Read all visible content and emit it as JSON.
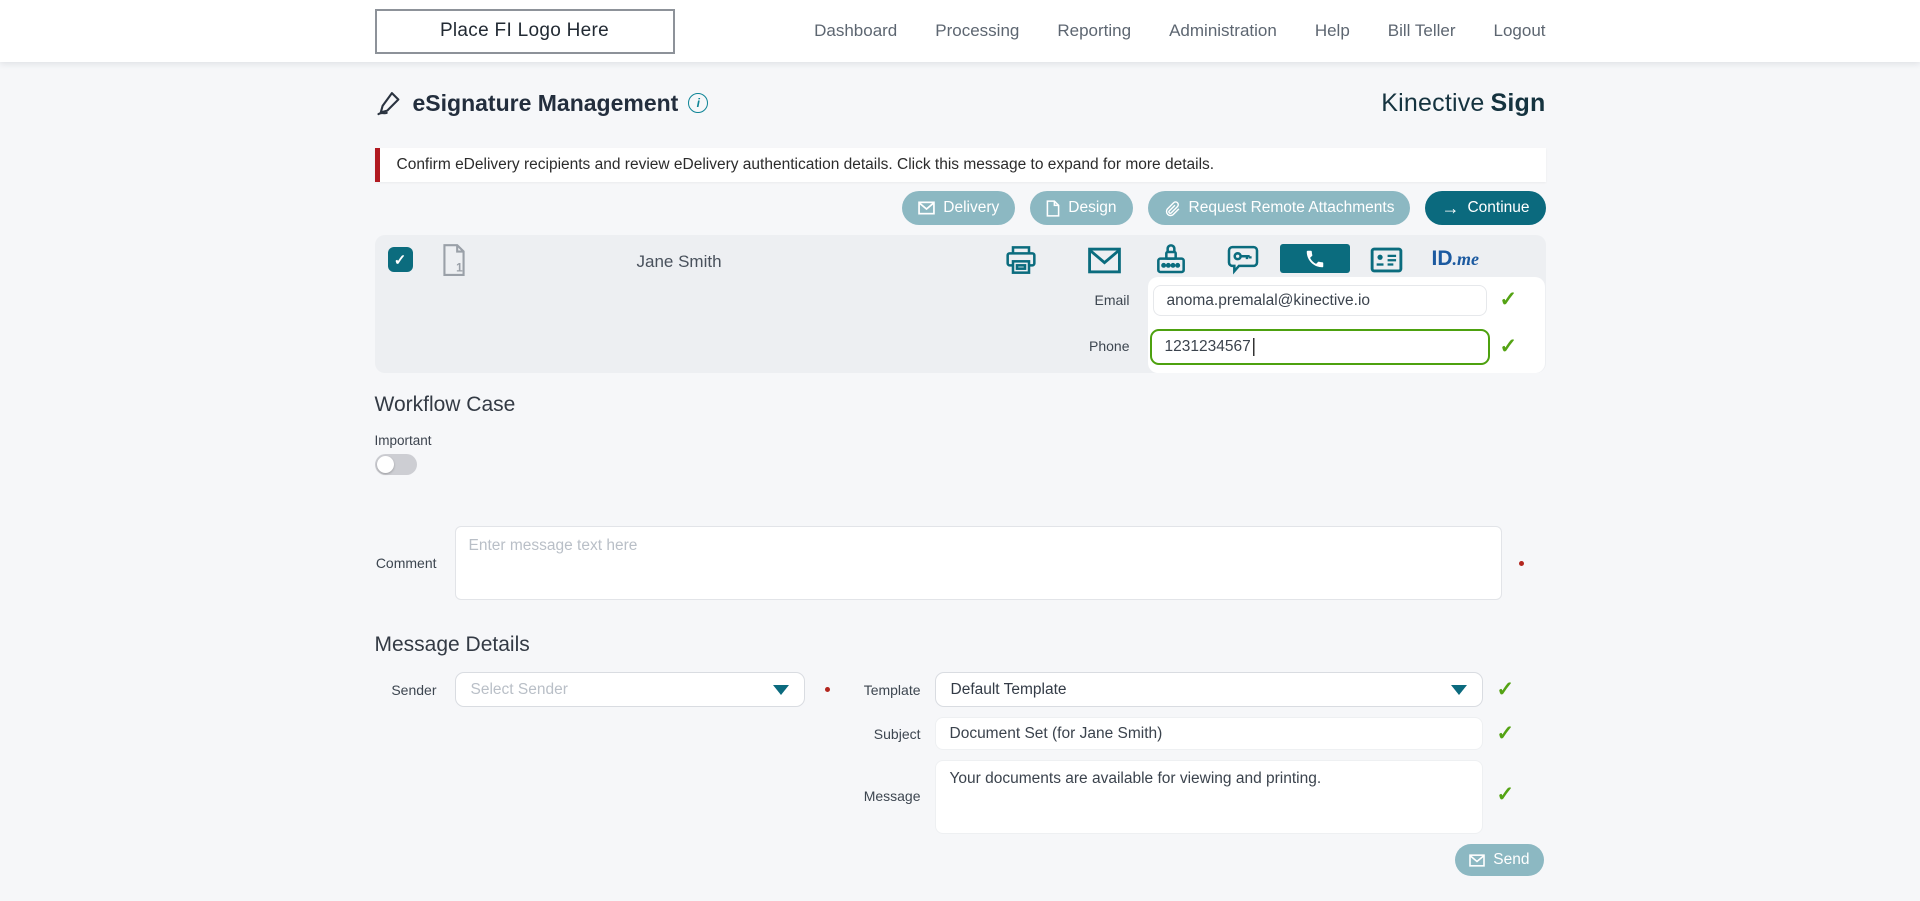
{
  "nav": {
    "logo_text": "Place FI Logo Here",
    "items": [
      {
        "label": "Dashboard"
      },
      {
        "label": "Processing"
      },
      {
        "label": "Reporting"
      },
      {
        "label": "Administration"
      },
      {
        "label": "Help"
      },
      {
        "label": "Bill Teller"
      },
      {
        "label": "Logout"
      }
    ]
  },
  "header": {
    "title": "eSignature Management",
    "info_glyph": "i",
    "brand_name": "Kinective",
    "brand_product": "Sign"
  },
  "alert": {
    "message": "Confirm eDelivery recipients and review eDelivery authentication details. Click this message to expand for more details."
  },
  "toolbar": {
    "delivery_label": "Delivery",
    "design_label": "Design",
    "request_remote_attachments_label": "Request Remote Attachments",
    "continue_label": "Continue",
    "continue_arrow": "→"
  },
  "recipient": {
    "checkbox_glyph": "✓",
    "document_count": "1",
    "name": "Jane Smith",
    "idme_id": "ID",
    "idme_me": ".me",
    "email_label": "Email",
    "email_value": "anoma.premalal@kinective.io",
    "phone_label": "Phone",
    "phone_value": "1231234567",
    "valid_glyph": "✓"
  },
  "workflow_case": {
    "heading": "Workflow Case",
    "important_label": "Important",
    "comment_label": "Comment",
    "comment_placeholder": "Enter message text here"
  },
  "message_details": {
    "heading": "Message Details",
    "sender_label": "Sender",
    "sender_placeholder": "Select Sender",
    "template_label": "Template",
    "template_value": "Default Template",
    "subject_label": "Subject",
    "subject_value": "Document Set (for Jane Smith)",
    "message_label": "Message",
    "message_value": "Your documents are available for viewing and printing.",
    "send_label": "Send",
    "valid_glyph": "✓"
  },
  "colors": {
    "teal": "#0b6a7e",
    "muted_teal": "#8cb8c2",
    "valid_green": "#54a314",
    "alert_red": "#b11a21",
    "idme_blue": "#1c5aa0"
  }
}
